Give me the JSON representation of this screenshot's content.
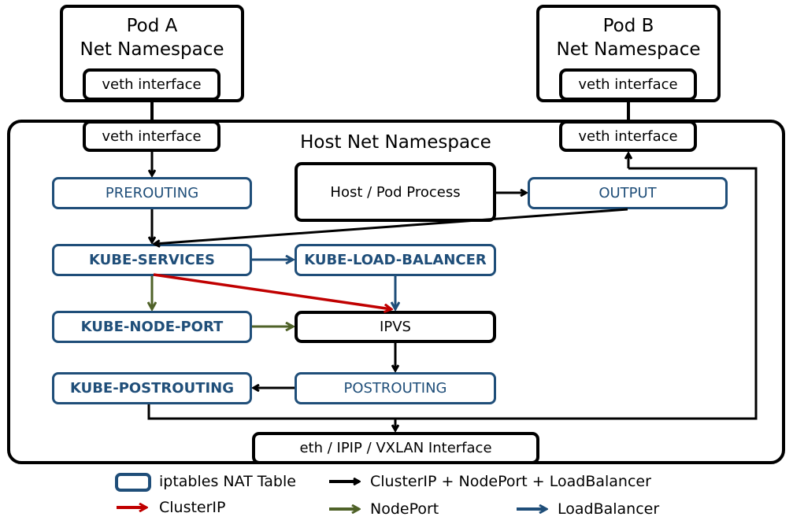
{
  "pods": {
    "pod_a": {
      "title_line1": "Pod A",
      "title_line2": "Net Namespace",
      "veth": "veth interface"
    },
    "pod_b": {
      "title_line1": "Pod B",
      "title_line2": "Net Namespace",
      "veth": "veth interface"
    }
  },
  "host": {
    "title": "Host Net Namespace",
    "veth_a": "veth interface",
    "veth_b": "veth interface",
    "process": "Host / Pod Process",
    "eth": "eth / IPIP / VXLAN Interface"
  },
  "chains": {
    "prerouting": "PREROUTING",
    "output": "OUTPUT",
    "kube_services": "KUBE-SERVICES",
    "kube_load_balancer": "KUBE-LOAD-BALANCER",
    "kube_node_port": "KUBE-NODE-PORT",
    "ipvs": "IPVS",
    "kube_postrouting": "KUBE-POSTROUTING",
    "postrouting": "POSTROUTING"
  },
  "legend": {
    "nat_table": "iptables NAT Table",
    "all": "ClusterIP + NodePort + LoadBalancer",
    "clusterip": "ClusterIP",
    "nodeport": "NodePort",
    "loadbalancer": "LoadBalancer"
  },
  "colors": {
    "all": "#000000",
    "clusterip": "#c00000",
    "nodeport": "#4f6228",
    "loadbalancer": "#1f4e79",
    "nat_border": "#1f4e79"
  }
}
